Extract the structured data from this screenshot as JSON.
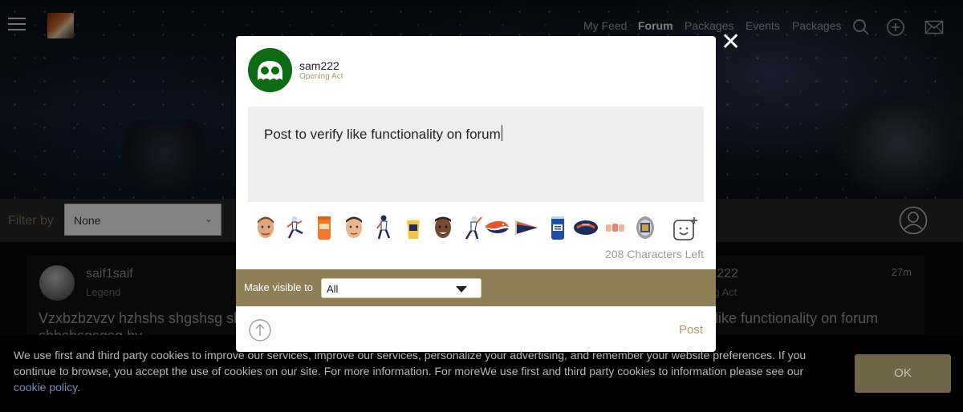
{
  "nav": {
    "links": [
      "My Feed",
      "Forum",
      "Packages",
      "Events",
      "Packages"
    ],
    "active": "Forum"
  },
  "filter": {
    "label": "Filter by",
    "value": "None"
  },
  "feed": {
    "left_card": {
      "username": "saif1saif",
      "rank": "Legend",
      "body": "Vzxbzbzvzv hzhshs shgshsg sh",
      "body2": "shbsbsgsgsg hy"
    },
    "right_card": {
      "username": "am222",
      "rank": "ning Act",
      "time": "27m",
      "body": "ify like functionality on forum"
    }
  },
  "cookie": {
    "text": "We use first and third party cookies to improve our services, improve our services, personalize your advertising, and remember your website preferences. If you continue to browse, you accept the use of cookies on our site. For more information. For moreWe use first and third party cookies to information please see our",
    "link": "cookie policy",
    "ok_label": "OK"
  },
  "modal": {
    "close_glyph": "✕",
    "username": "sam222",
    "rank": "Opening Act",
    "post_text": "Post to verify like functionality on forum",
    "emojis": [
      "player-face-1",
      "kicker",
      "orange-can",
      "player-face-2",
      "running-player",
      "beer-cup",
      "player-face-3",
      "throwing-player",
      "broncos-logo",
      "pennant-flag",
      "bud-light-can",
      "broncos-football",
      "hands-clap",
      "trophy-ring"
    ],
    "chars_left": "208 Characters Left",
    "visibility_label": "Make visible to",
    "visibility_value": "All",
    "post_label": "Post"
  },
  "colors": {
    "accent_gold": "#8f7f56",
    "avatar_green": "#0d6b14",
    "broncos_orange": "#e4572e",
    "broncos_navy": "#1b2d5c"
  }
}
